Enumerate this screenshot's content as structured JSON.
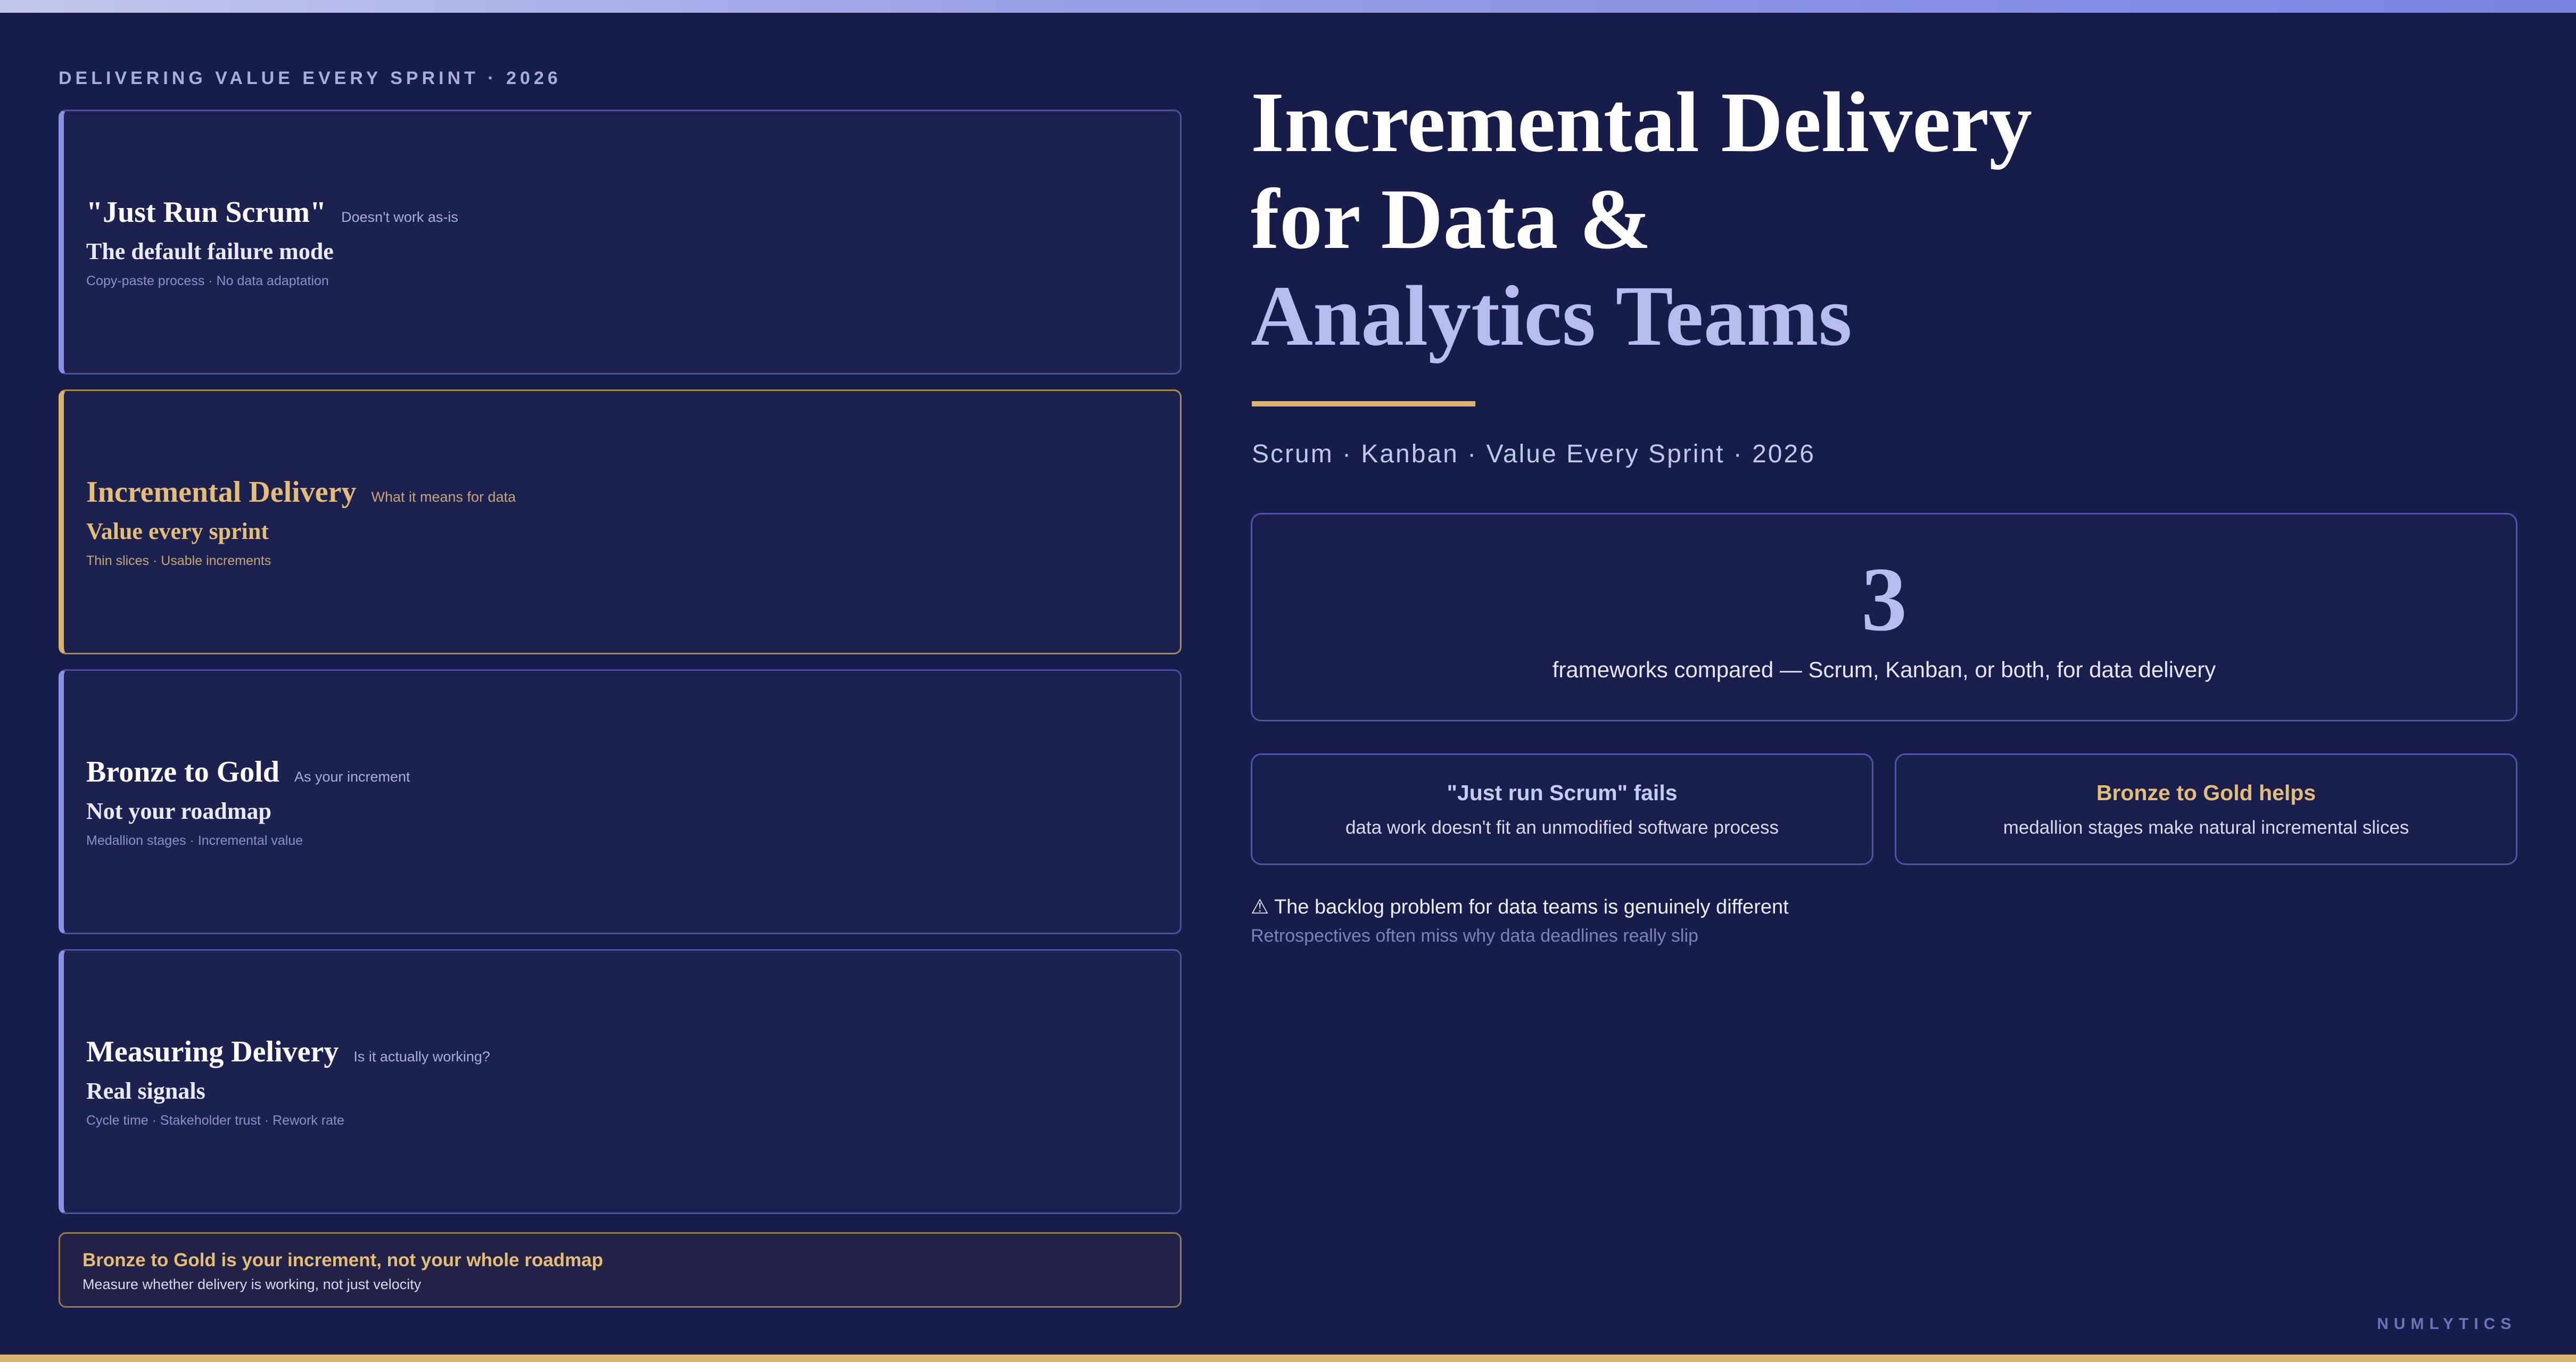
{
  "kicker": "DELIVERING VALUE EVERY SPRINT · 2026",
  "cards": [
    {
      "title": "\"Just Run Scrum\"",
      "tag": "Doesn't work as-is",
      "subtitle": "The default failure mode",
      "meta": "Copy-paste process · No data adaptation"
    },
    {
      "title": "Incremental Delivery",
      "tag": "What it means for data",
      "subtitle": "Value every sprint",
      "meta": "Thin slices · Usable increments"
    },
    {
      "title": "Bronze to Gold",
      "tag": "As your increment",
      "subtitle": "Not your roadmap",
      "meta": "Medallion stages · Incremental value"
    },
    {
      "title": "Measuring Delivery",
      "tag": "Is it actually working?",
      "subtitle": "Real signals",
      "meta": "Cycle time · Stakeholder trust · Rework rate"
    }
  ],
  "callout": {
    "title": "Bronze to Gold is your increment, not your whole roadmap",
    "text": "Measure whether delivery is working, not just velocity"
  },
  "hero": {
    "line1": "Incremental Delivery",
    "line2": "for Data &",
    "line3": "Analytics Teams",
    "subtitle": "Scrum · Kanban · Value Every Sprint · 2026"
  },
  "stat": {
    "number": "3",
    "label": "frameworks compared — Scrum, Kanban, or both, for data delivery"
  },
  "mini_cards": [
    {
      "title": "\"Just run Scrum\" fails",
      "text": "data work doesn't fit an unmodified software process"
    },
    {
      "title": "Bronze to Gold helps",
      "text": "medallion stages make natural incremental slices"
    }
  ],
  "warning": {
    "icon": "warning-icon",
    "text": "⚠ The backlog problem for data teams is genuinely different",
    "subtext": "Retrospectives often miss why data deadlines really slip"
  },
  "brand": "NUMLYTICS",
  "colors": {
    "background": "#181c4a",
    "accent_lavender": "#b7bbee",
    "accent_gold": "#d9b46e"
  }
}
